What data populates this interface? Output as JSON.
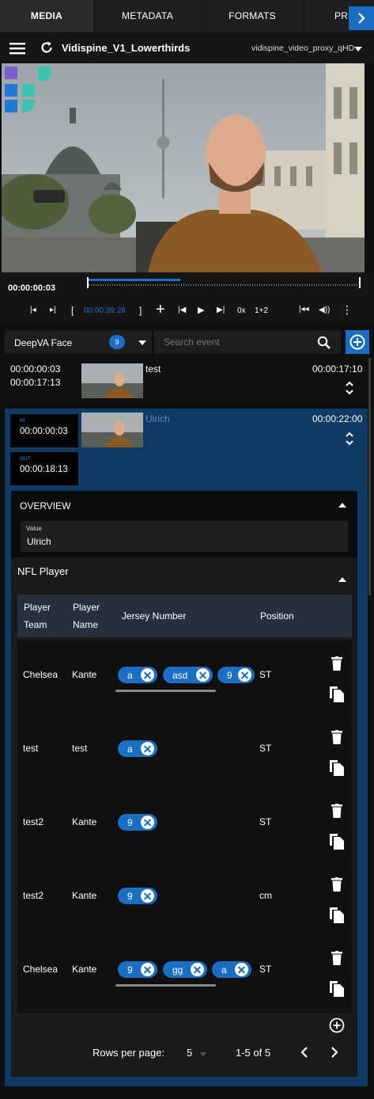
{
  "tabs": [
    "MEDIA",
    "METADATA",
    "FORMATS",
    "PRO"
  ],
  "header": {
    "title": "Vidispine_V1_Lowerthirds",
    "proxy": "vidispine_video_proxy_qHD"
  },
  "timeline": {
    "current": "00:00:00:03",
    "marker": "00:00:39:28",
    "speed": "0x",
    "channels": "1+2",
    "progress": 0.34
  },
  "search": {
    "detector": "DeepVA Face",
    "count": "9",
    "placeholder": "Search event"
  },
  "items": [
    {
      "start": "00:00:00:03",
      "end": "00:00:17:13",
      "label": "test",
      "duration": "00:00:17:10"
    },
    {
      "in_label": "IN",
      "in": "00:00:00:03",
      "out_label": "OUT",
      "out": "00:00:18:13",
      "label": "Ulrich",
      "duration": "00:00:22:00"
    }
  ],
  "overview": {
    "title": "OVERVIEW",
    "value_label": "Value",
    "value": "Ulrich"
  },
  "nfl": {
    "title": "NFL Player",
    "columns": [
      {
        "l1": "Player",
        "l2": "Team"
      },
      {
        "l1": "Player",
        "l2": "Name"
      },
      {
        "l1": "Jersey Number",
        "l2": ""
      },
      {
        "l1": "Position",
        "l2": ""
      }
    ],
    "rows": [
      {
        "team": "Chelsea",
        "name": "Kante",
        "chips": [
          "a",
          "asd",
          "9"
        ],
        "position": "ST"
      },
      {
        "team": "test",
        "name": "test",
        "chips": [
          "a"
        ],
        "position": "ST"
      },
      {
        "team": "test2",
        "name": "Kante",
        "chips": [
          "9"
        ],
        "position": "ST"
      },
      {
        "team": "test2",
        "name": "Kante",
        "chips": [
          "9"
        ],
        "position": "cm"
      },
      {
        "team": "Chelsea",
        "name": "Kante",
        "chips": [
          "9",
          "gg",
          "a"
        ],
        "position": "ST"
      }
    ],
    "rows_per_page_label": "Rows per page:",
    "rows_per_page": "5",
    "range": "1-5 of 5"
  },
  "colors": {
    "accent": "#1a6fc4",
    "panel": "#0f3a63",
    "tc_label": "#2a8ae0"
  }
}
